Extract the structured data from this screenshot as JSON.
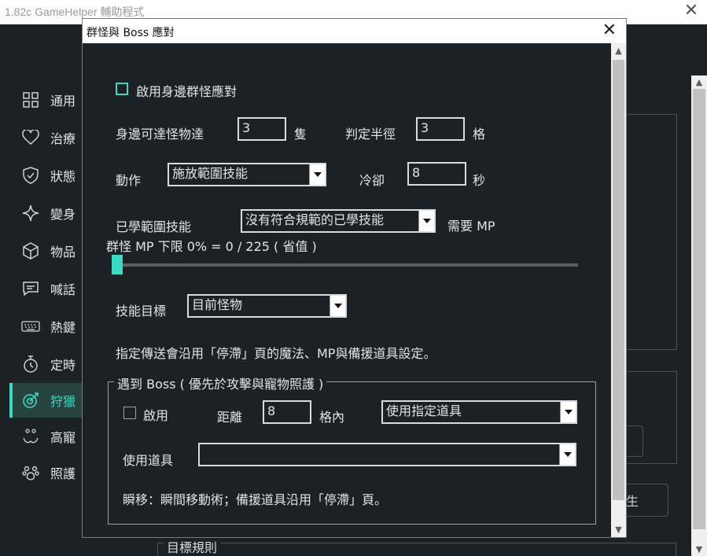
{
  "main_window": {
    "title": "1.82c GameHelper 輔助程式",
    "close_glyph": "✕",
    "sidebar": [
      {
        "label": "通用",
        "icon": "grid-icon"
      },
      {
        "label": "治療",
        "icon": "heart-icon"
      },
      {
        "label": "狀態",
        "icon": "shield-icon"
      },
      {
        "label": "變身",
        "icon": "sparkle-icon"
      },
      {
        "label": "物品",
        "icon": "cube-icon"
      },
      {
        "label": "喊話",
        "icon": "chat-icon"
      },
      {
        "label": "熱鍵",
        "icon": "keyboard-icon"
      },
      {
        "label": "定時",
        "icon": "timer-icon"
      },
      {
        "label": "狩獵",
        "icon": "target-icon",
        "active": true
      },
      {
        "label": "高寵",
        "icon": "pet-face-icon"
      },
      {
        "label": "照護",
        "icon": "paw-icon"
      }
    ],
    "partial_button_text": "生",
    "bottom_group_label": "目標規則",
    "accent_color": "#3dd8c3"
  },
  "dialog": {
    "title": "群怪與 Boss 應對",
    "close_glyph": "✕",
    "enable_mob_label": "啟用身邊群怪應對",
    "nearby_count_label": "身邊可達怪物達",
    "nearby_count_value": "3",
    "nearby_unit": "隻",
    "radius_label": "判定半徑",
    "radius_value": "3",
    "radius_unit": "格",
    "action_label": "動作",
    "action_value": "施放範圍技能",
    "cooldown_label": "冷卻",
    "cooldown_value": "8",
    "cooldown_unit": "秒",
    "learned_skill_label": "已學範圍技能",
    "learned_skill_value": "沒有符合規範的已學技能",
    "mp_required_label": "需要 MP",
    "mp_limit_label": "群怪 MP 下限  0% = 0 / 225 ( 省值 )",
    "mp_limit_percent": 0,
    "skill_target_label": "技能目標",
    "skill_target_value": "目前怪物",
    "note_text": "指定傳送會沿用「停滯」頁的魔法、MP與備援道具設定。",
    "boss": {
      "legend": "遇到 Boss ( 優先於攻擊與寵物照護 )",
      "enable_label": "啟用",
      "distance_label": "距離",
      "distance_value": "8",
      "distance_unit": "格內",
      "mode_value": "使用指定道具",
      "use_item_label": "使用道具",
      "use_item_value": "",
      "note_text": "瞬移：瞬間移動術；備援道具沿用「停滯」頁。"
    }
  }
}
